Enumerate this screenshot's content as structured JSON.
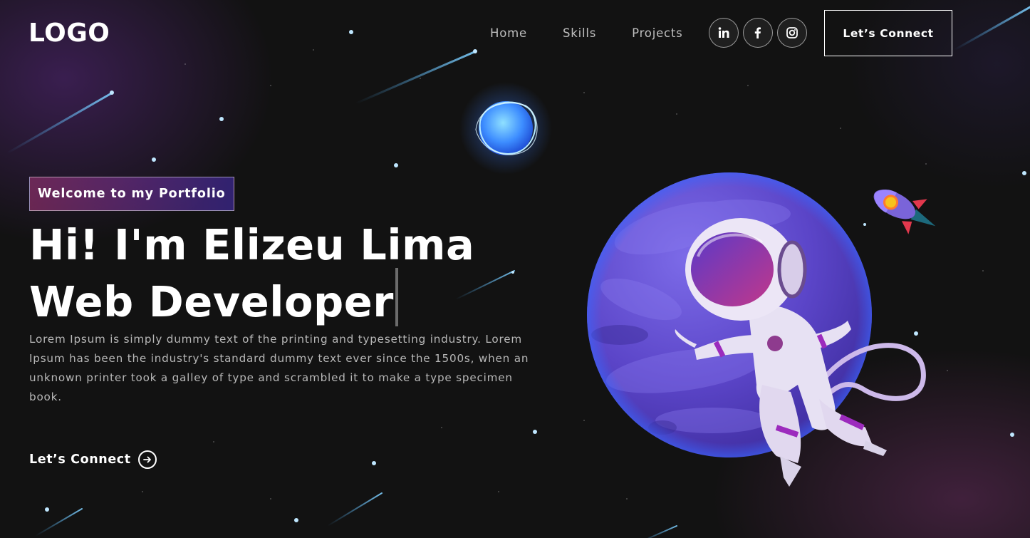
{
  "nav": {
    "logo": "LOGO",
    "links": [
      {
        "label": "Home"
      },
      {
        "label": "Skills"
      },
      {
        "label": "Projects"
      }
    ],
    "socials": [
      {
        "icon": "linkedin-icon"
      },
      {
        "icon": "facebook-icon"
      },
      {
        "icon": "instagram-icon"
      }
    ],
    "connect_label": "Let’s Connect"
  },
  "hero": {
    "tagline": "Welcome to my Portfolio",
    "headline": "Hi! I'm Elizeu Lima Web Developer",
    "intro": "Lorem Ipsum is simply dummy text of the printing and typesetting industry. Lorem Ipsum has been the industry's standard dummy text ever since the 1500s, when an unknown printer took a galley of type and scrambled it to make a type specimen book.",
    "cta_label": "Let’s Connect",
    "cta_icon": "arrow-right-circle-icon"
  },
  "illustration": {
    "items": [
      "astronaut",
      "purple-planet",
      "blue-orb",
      "rocket"
    ]
  },
  "colors": {
    "background": "#121212",
    "accent_pink": "#aa367c",
    "accent_purple": "#4a2fbd",
    "text_muted": "#b8b8b8"
  }
}
